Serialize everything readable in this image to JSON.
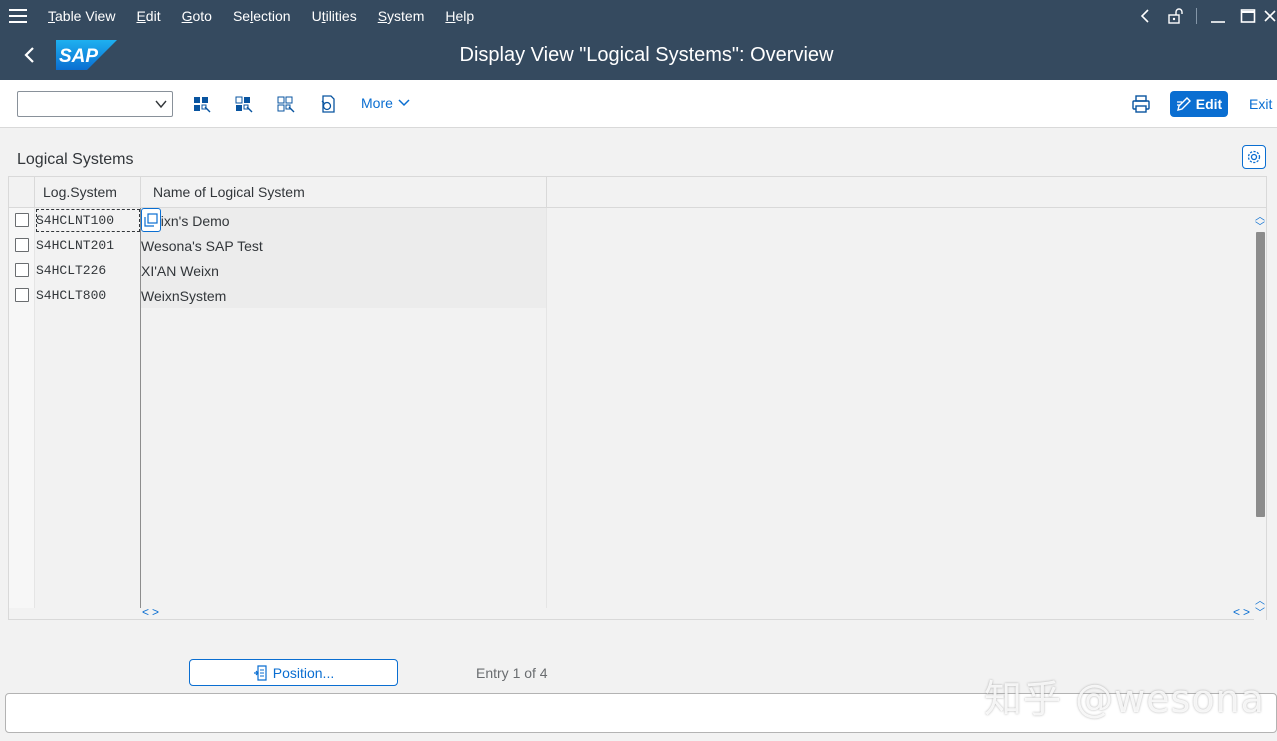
{
  "menubar": {
    "items": [
      "Table View",
      "Edit",
      "Goto",
      "Selection",
      "Utilities",
      "System",
      "Help"
    ],
    "mnemonics": [
      "T",
      "E",
      "G",
      "l",
      "t",
      "S",
      "H"
    ]
  },
  "titlebar": {
    "title": "Display View \"Logical Systems\": Overview",
    "logo_text": "SAP"
  },
  "toolbar": {
    "command_value": "",
    "more_label": "More",
    "edit_label": "Edit",
    "exit_label": "Exit"
  },
  "section": {
    "title": "Logical Systems"
  },
  "table": {
    "headers": [
      "Log.System",
      "Name of Logical System"
    ],
    "rows": [
      {
        "system": "S4HCLNT100",
        "name": "eixn's Demo"
      },
      {
        "system": "S4HCLNT201",
        "name": "Wesona's SAP Test"
      },
      {
        "system": "S4HCLT226",
        "name": "XI'AN Weixn"
      },
      {
        "system": "S4HCLT800",
        "name": "WeixnSystem"
      }
    ],
    "empty_rows": 12
  },
  "footer": {
    "position_label": "Position...",
    "entry_info": "Entry 1 of 4"
  },
  "watermark": "知乎 @wesona",
  "colors": {
    "shell": "#354a5f",
    "accent": "#0a6ed1",
    "background": "#f2f2f2"
  }
}
